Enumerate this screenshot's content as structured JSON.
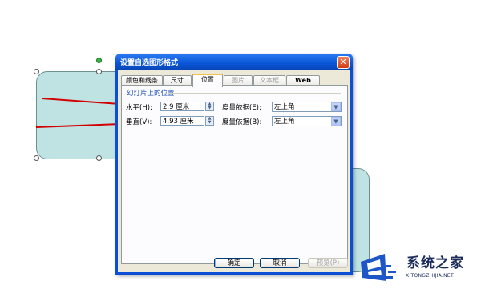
{
  "dialog": {
    "title": "设置自选图形格式",
    "close_symbol": "✕",
    "tabs": [
      {
        "label": "颜色和线条",
        "state": "normal"
      },
      {
        "label": "尺寸",
        "state": "normal"
      },
      {
        "label": "位置",
        "state": "active"
      },
      {
        "label": "图片",
        "state": "disabled"
      },
      {
        "label": "文本框",
        "state": "disabled"
      },
      {
        "label": "Web",
        "state": "normal"
      }
    ],
    "group_title": "幻灯片上的位置",
    "horizontal": {
      "label": "水平(H):",
      "value": "2.9 厘米",
      "measure_label": "度量依据(E):",
      "measure_value": "左上角"
    },
    "vertical": {
      "label": "垂直(V):",
      "value": "4.93 厘米",
      "measure_label": "度量依据(B):",
      "measure_value": "左上角"
    },
    "buttons": {
      "ok": "确定",
      "cancel": "取消",
      "preview": "预览(P)"
    }
  },
  "annotation": {
    "arrow_color": "#d40000"
  },
  "watermark": {
    "brand": "系统之家",
    "url": "XITONGZHIJIA.NET"
  },
  "colors": {
    "titlebar": "#0a56d8",
    "dialog_face": "#ece9d8",
    "shape_fill": "#bfe3e3"
  }
}
